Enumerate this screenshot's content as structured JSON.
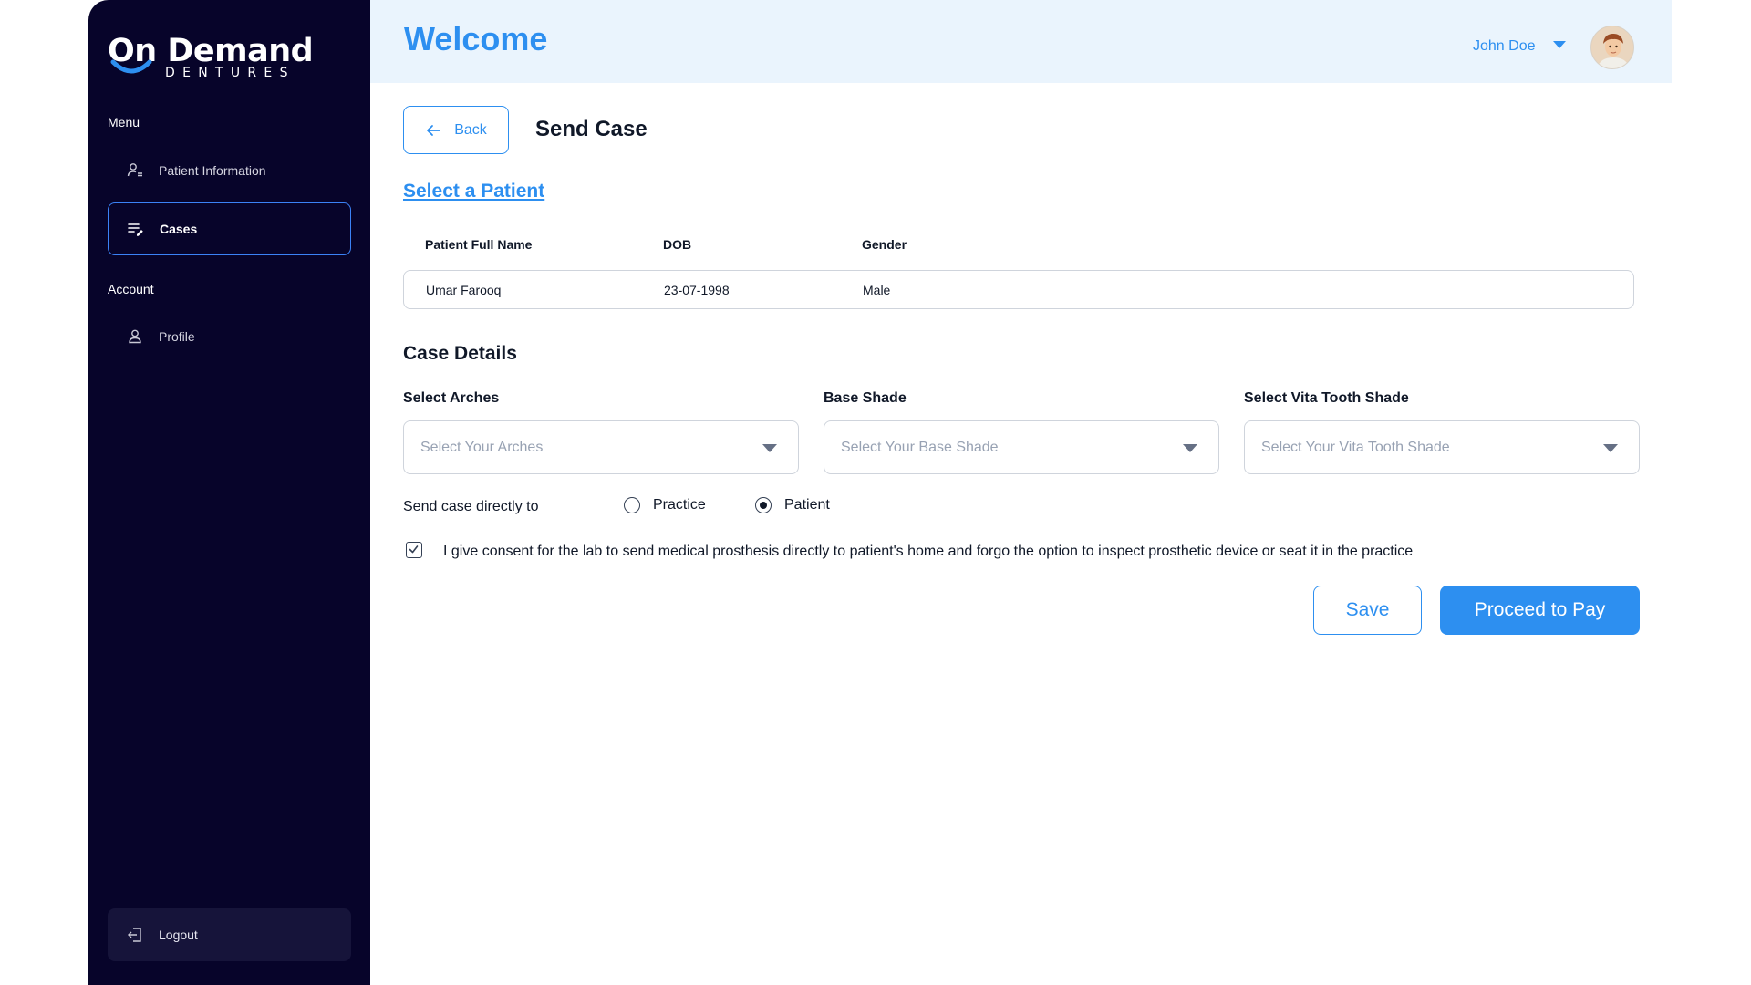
{
  "brand": {
    "name_top": "On Demand",
    "name_bottom": "DENTURES"
  },
  "sidebar": {
    "menu_label": "Menu",
    "account_label": "Account",
    "items": [
      {
        "label": "Patient Information",
        "icon": "patient-info-icon",
        "active": false
      },
      {
        "label": "Cases",
        "icon": "cases-icon",
        "active": true
      },
      {
        "label": "Profile",
        "icon": "profile-icon",
        "active": false
      }
    ],
    "logout_label": "Logout"
  },
  "header": {
    "title": "Welcome",
    "user_name": "John Doe"
  },
  "page": {
    "back_label": "Back",
    "title": "Send Case",
    "select_patient_link": "Select a Patient"
  },
  "patient_table": {
    "columns": [
      "Patient Full Name",
      "DOB",
      "Gender"
    ],
    "rows": [
      [
        "Umar Farooq",
        "23-07-1998",
        "Male"
      ]
    ]
  },
  "case_details": {
    "title": "Case Details",
    "fields": [
      {
        "label": "Select Arches",
        "placeholder": "Select Your Arches"
      },
      {
        "label": "Base Shade",
        "placeholder": "Select Your Base Shade"
      },
      {
        "label": "Select Vita Tooth Shade",
        "placeholder": "Select Your Vita Tooth Shade"
      }
    ],
    "send_to_label": "Send case directly to",
    "send_to_options": [
      {
        "label": "Practice",
        "selected": false
      },
      {
        "label": "Patient",
        "selected": true
      }
    ],
    "consent_checked": true,
    "consent_text": "I give consent for the lab to send medical prosthesis directly to patient's home and forgo the option to inspect prosthetic device or seat it in the practice"
  },
  "actions": {
    "save_label": "Save",
    "pay_label": "Proceed to Pay"
  },
  "colors": {
    "accent": "#2d8ff0",
    "sidebar_bg": "#07042a",
    "header_bg": "#eaf4fd"
  }
}
